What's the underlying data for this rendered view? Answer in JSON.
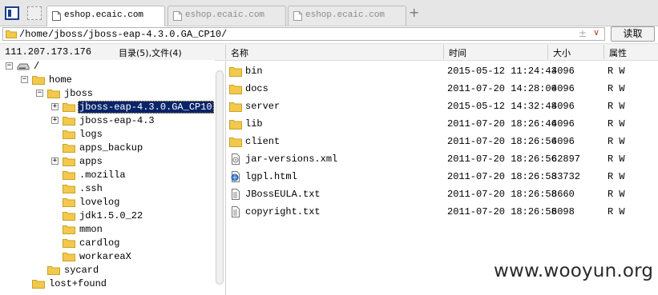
{
  "tabs": [
    {
      "label": "eshop.ecaic.com",
      "active": true
    },
    {
      "label": "eshop.ecaic.com",
      "active": false
    },
    {
      "label": "eshop.ecaic.com",
      "active": false
    }
  ],
  "new_tab_label": "+",
  "address": {
    "path": "/home/jboss/jboss-eap-4.3.0.GA_CP10/",
    "plusminus": "±",
    "dropdown": "∨",
    "read_button": "读取"
  },
  "info": {
    "ip": "111.207.173.176",
    "dir_summary": "目录(5),文件(4)"
  },
  "columns": {
    "name": "名称",
    "time": "时间",
    "size": "大小",
    "attr": "属性"
  },
  "tree": [
    {
      "label": "/",
      "icon": "drive-icon",
      "expander": "−"
    },
    {
      "label": "home",
      "icon": "folder-icon",
      "expander": "−"
    },
    {
      "label": "jboss",
      "icon": "folder-icon",
      "expander": "−"
    },
    {
      "label": "jboss-eap-4.3.0.GA_CP10",
      "icon": "folder-icon",
      "expander": "+",
      "selected": true
    },
    {
      "label": "jboss-eap-4.3",
      "icon": "folder-icon",
      "expander": "+"
    },
    {
      "label": "logs",
      "icon": "folder-icon",
      "expander": ""
    },
    {
      "label": "apps_backup",
      "icon": "folder-icon",
      "expander": ""
    },
    {
      "label": "apps",
      "icon": "folder-icon",
      "expander": "+"
    },
    {
      "label": ".mozilla",
      "icon": "folder-icon",
      "expander": ""
    },
    {
      "label": ".ssh",
      "icon": "folder-icon",
      "expander": ""
    },
    {
      "label": "lovelog",
      "icon": "folder-icon",
      "expander": ""
    },
    {
      "label": "jdk1.5.0_22",
      "icon": "folder-icon",
      "expander": ""
    },
    {
      "label": "mmon",
      "icon": "folder-icon",
      "expander": ""
    },
    {
      "label": "cardlog",
      "icon": "folder-icon",
      "expander": ""
    },
    {
      "label": "workareaX",
      "icon": "folder-icon",
      "expander": ""
    },
    {
      "label": "sycard",
      "icon": "folder-icon",
      "expander": ""
    },
    {
      "label": "lost+found",
      "icon": "folder-icon",
      "expander": ""
    }
  ],
  "files": [
    {
      "name": "bin",
      "type": "folder-icon",
      "time": "2015-05-12 11:24:43",
      "size": "4096",
      "attr": "R W"
    },
    {
      "name": "docs",
      "type": "folder-icon",
      "time": "2011-07-20 14:28:00",
      "size": "4096",
      "attr": "R W"
    },
    {
      "name": "server",
      "type": "folder-icon",
      "time": "2015-05-12 14:32:48",
      "size": "4096",
      "attr": "R W"
    },
    {
      "name": "lib",
      "type": "folder-icon",
      "time": "2011-07-20 18:26:46",
      "size": "4096",
      "attr": "R W"
    },
    {
      "name": "client",
      "type": "folder-icon",
      "time": "2011-07-20 18:26:56",
      "size": "4096",
      "attr": "R W"
    },
    {
      "name": "jar-versions.xml",
      "type": "xml-file-icon",
      "time": "2011-07-20 18:26:56",
      "size": "62897",
      "attr": "R W"
    },
    {
      "name": "lgpl.html",
      "type": "html-file-icon",
      "time": "2011-07-20 18:26:58",
      "size": "33732",
      "attr": "R W"
    },
    {
      "name": "JBossEULA.txt",
      "type": "text-file-icon",
      "time": "2011-07-20 18:26:58",
      "size": "8660",
      "attr": "R W"
    },
    {
      "name": "copyright.txt",
      "type": "text-file-icon",
      "time": "2011-07-20 18:26:58",
      "size": "6098",
      "attr": "R W"
    }
  ],
  "watermark": "www.wooyun.org",
  "colors": {
    "folder": "#f2c94c",
    "folder_border": "#c9a227",
    "selection": "#0a246a"
  }
}
